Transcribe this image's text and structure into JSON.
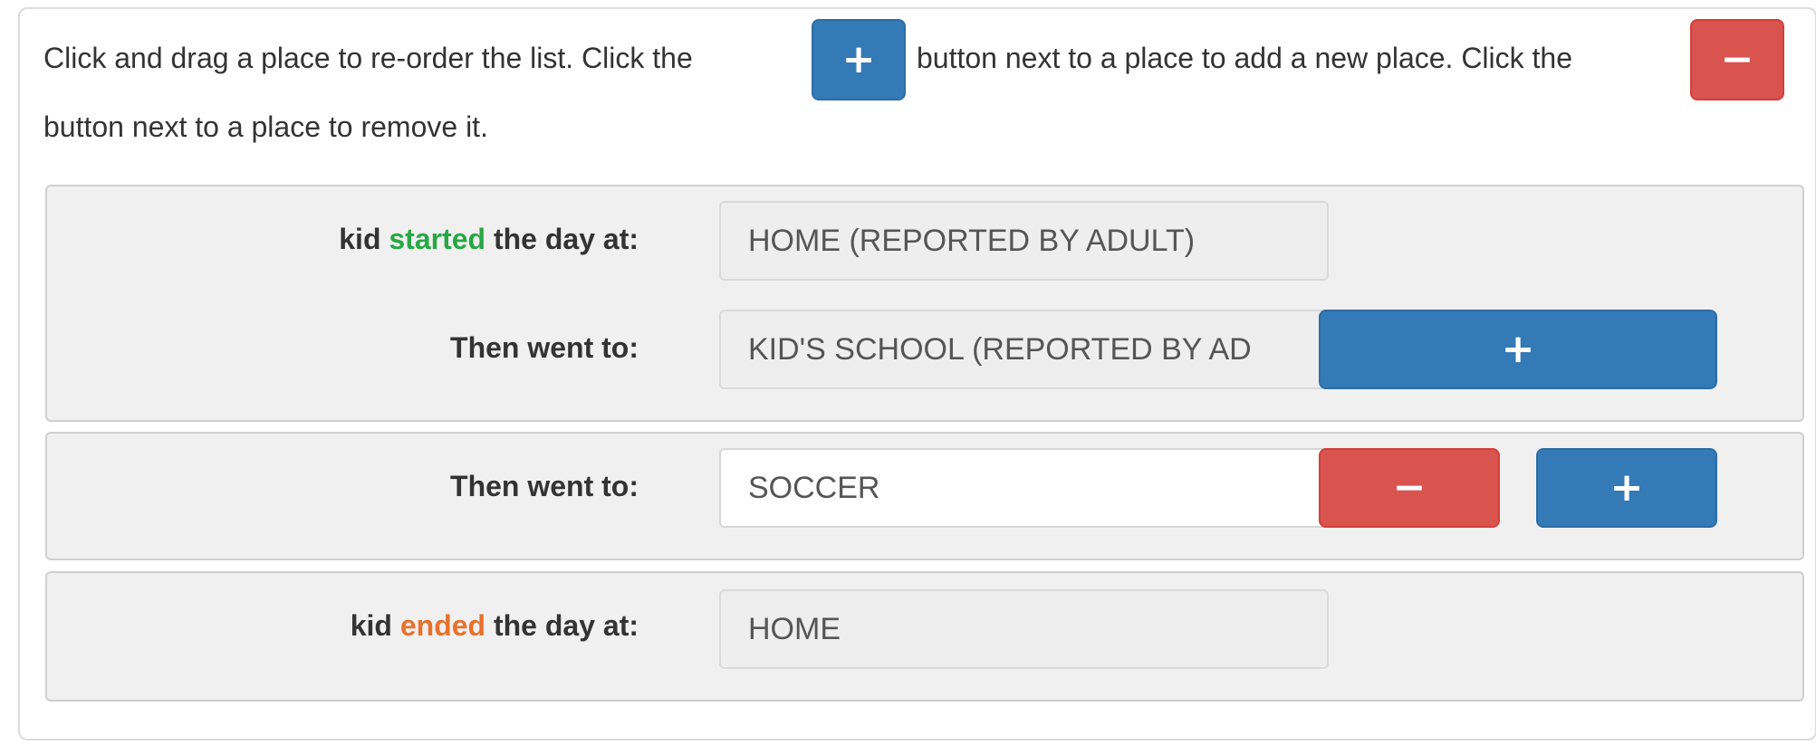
{
  "instructions": {
    "part1": "Click and drag a place to re-order the list. Click the",
    "part2": "button next to a place to add a new place. Click the",
    "part3": "button next to a place to remove it."
  },
  "inline_add_glyph": "+",
  "inline_remove_glyph": "−",
  "rows": {
    "start": {
      "label_prefix": "kid",
      "label_highlight": "started",
      "label_suffix": "the day at:",
      "value": "HOME (REPORTED BY ADULT)"
    },
    "then1": {
      "label": "Then went to:",
      "value": "KID'S SCHOOL (REPORTED BY AD",
      "add_glyph": "+"
    },
    "then2": {
      "label": "Then went to:",
      "value": "SOCCER",
      "remove_glyph": "−",
      "add_glyph": "+"
    },
    "end": {
      "label_prefix": "kid",
      "label_highlight": "ended",
      "label_suffix": "the day at:",
      "value": "HOME"
    }
  },
  "colors": {
    "add_button": "#337ab7",
    "remove_button": "#d9534f",
    "started_highlight": "#28a745",
    "ended_highlight": "#e8712b"
  }
}
